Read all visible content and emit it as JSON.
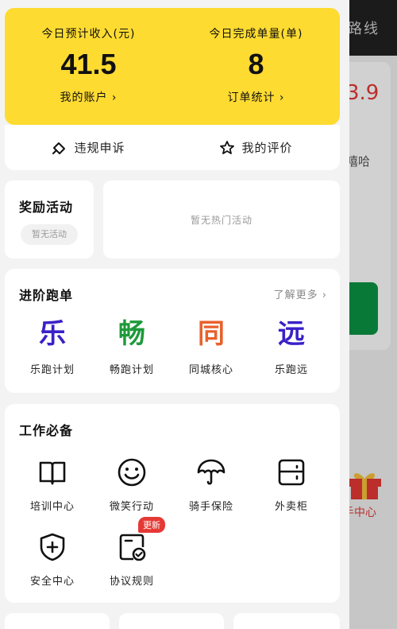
{
  "background": {
    "top_text": "路线",
    "price": "3.9",
    "text1": "嘻哈",
    "gift_label": "手中心"
  },
  "stats": {
    "income_label": "今日预计收入(元)",
    "income_value": "41.5",
    "account_link": "我的账户 ›",
    "orders_label": "今日完成单量(单)",
    "orders_value": "8",
    "orders_link": "订单统计 ›"
  },
  "links": {
    "appeal": "违规申诉",
    "review": "我的评价"
  },
  "reward": {
    "title": "奖励活动",
    "empty_pill": "暂无活动",
    "hot_empty": "暂无热门活动"
  },
  "advanced": {
    "title": "进阶跑单",
    "more": "了解更多",
    "items": [
      {
        "char": "乐",
        "label": "乐跑计划",
        "color": "#3a20c8"
      },
      {
        "char": "畅",
        "label": "畅跑计划",
        "color": "#1e9a3a"
      },
      {
        "char": "同",
        "label": "同城核心",
        "color": "#e8612c"
      },
      {
        "char": "远",
        "label": "乐跑远",
        "color": "#3a20c8"
      }
    ]
  },
  "work": {
    "title": "工作必备",
    "items": [
      {
        "label": "培训中心",
        "icon": "book-icon"
      },
      {
        "label": "微笑行动",
        "icon": "smile-icon"
      },
      {
        "label": "骑手保险",
        "icon": "umbrella-icon"
      },
      {
        "label": "外卖柜",
        "icon": "locker-icon"
      },
      {
        "label": "安全中心",
        "icon": "shield-plus-icon"
      },
      {
        "label": "协议规则",
        "icon": "document-check-icon",
        "badge": "更新"
      }
    ]
  }
}
